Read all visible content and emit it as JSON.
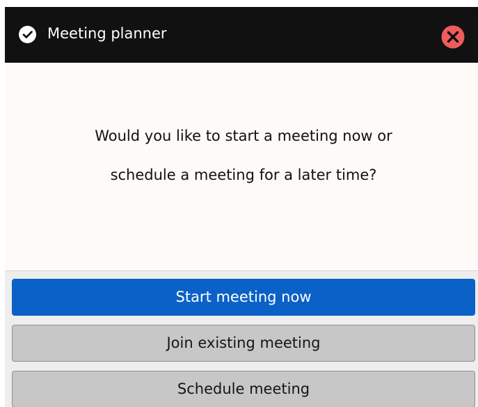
{
  "dialog": {
    "title": "Meeting planner",
    "title_icon": "check-circle-icon",
    "close_icon": "close-icon",
    "message_lines": [
      "Would you like to start a meeting now or",
      "schedule a meeting for a later time?"
    ]
  },
  "buttons": {
    "start": "Start meeting now",
    "join": "Join existing meeting",
    "schedule": "Schedule meeting"
  },
  "colors": {
    "titlebar": "#111111",
    "primary_button": "#0b61c7",
    "secondary_button": "#c7c7c7",
    "close_button": "#f05b5b",
    "dialog_background": "#fdfaf7"
  }
}
